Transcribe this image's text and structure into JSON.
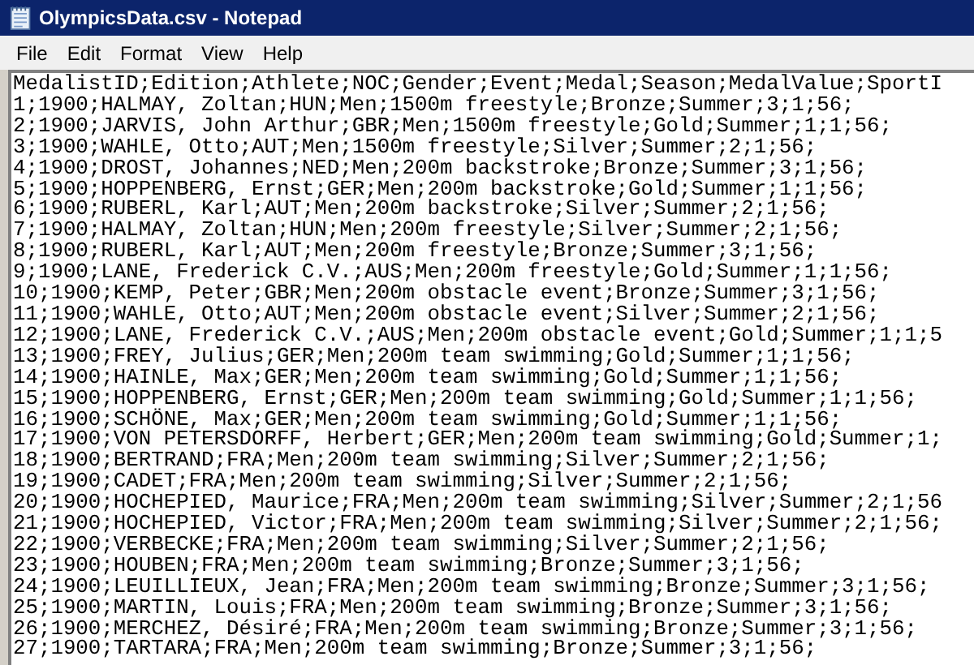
{
  "window": {
    "title": "OlympicsData.csv - Notepad"
  },
  "menu": [
    "File",
    "Edit",
    "Format",
    "View",
    "Help"
  ],
  "lines": [
    "MedalistID;Edition;Athlete;NOC;Gender;Event;Medal;Season;MedalValue;SportI",
    "1;1900;HALMAY, Zoltan;HUN;Men;1500m freestyle;Bronze;Summer;3;1;56;",
    "2;1900;JARVIS, John Arthur;GBR;Men;1500m freestyle;Gold;Summer;1;1;56;",
    "3;1900;WAHLE, Otto;AUT;Men;1500m freestyle;Silver;Summer;2;1;56;",
    "4;1900;DROST, Johannes;NED;Men;200m backstroke;Bronze;Summer;3;1;56;",
    "5;1900;HOPPENBERG, Ernst;GER;Men;200m backstroke;Gold;Summer;1;1;56;",
    "6;1900;RUBERL, Karl;AUT;Men;200m backstroke;Silver;Summer;2;1;56;",
    "7;1900;HALMAY, Zoltan;HUN;Men;200m freestyle;Silver;Summer;2;1;56;",
    "8;1900;RUBERL, Karl;AUT;Men;200m freestyle;Bronze;Summer;3;1;56;",
    "9;1900;LANE, Frederick C.V.;AUS;Men;200m freestyle;Gold;Summer;1;1;56;",
    "10;1900;KEMP, Peter;GBR;Men;200m obstacle event;Bronze;Summer;3;1;56;",
    "11;1900;WAHLE, Otto;AUT;Men;200m obstacle event;Silver;Summer;2;1;56;",
    "12;1900;LANE, Frederick C.V.;AUS;Men;200m obstacle event;Gold;Summer;1;1;5",
    "13;1900;FREY, Julius;GER;Men;200m team swimming;Gold;Summer;1;1;56;",
    "14;1900;HAINLE, Max;GER;Men;200m team swimming;Gold;Summer;1;1;56;",
    "15;1900;HOPPENBERG, Ernst;GER;Men;200m team swimming;Gold;Summer;1;1;56;",
    "16;1900;SCHÖNE, Max;GER;Men;200m team swimming;Gold;Summer;1;1;56;",
    "17;1900;VON PETERSDORFF, Herbert;GER;Men;200m team swimming;Gold;Summer;1;",
    "18;1900;BERTRAND;FRA;Men;200m team swimming;Silver;Summer;2;1;56;",
    "19;1900;CADET;FRA;Men;200m team swimming;Silver;Summer;2;1;56;",
    "20;1900;HOCHEPIED, Maurice;FRA;Men;200m team swimming;Silver;Summer;2;1;56",
    "21;1900;HOCHEPIED, Victor;FRA;Men;200m team swimming;Silver;Summer;2;1;56;",
    "22;1900;VERBECKE;FRA;Men;200m team swimming;Silver;Summer;2;1;56;",
    "23;1900;HOUBEN;FRA;Men;200m team swimming;Bronze;Summer;3;1;56;",
    "24;1900;LEUILLIEUX, Jean;FRA;Men;200m team swimming;Bronze;Summer;3;1;56;",
    "25;1900;MARTIN, Louis;FRA;Men;200m team swimming;Bronze;Summer;3;1;56;",
    "26;1900;MERCHEZ, Désiré;FRA;Men;200m team swimming;Bronze;Summer;3;1;56;",
    "27;1900;TARTARA;FRA;Men;200m team swimming;Bronze;Summer;3;1;56;"
  ]
}
